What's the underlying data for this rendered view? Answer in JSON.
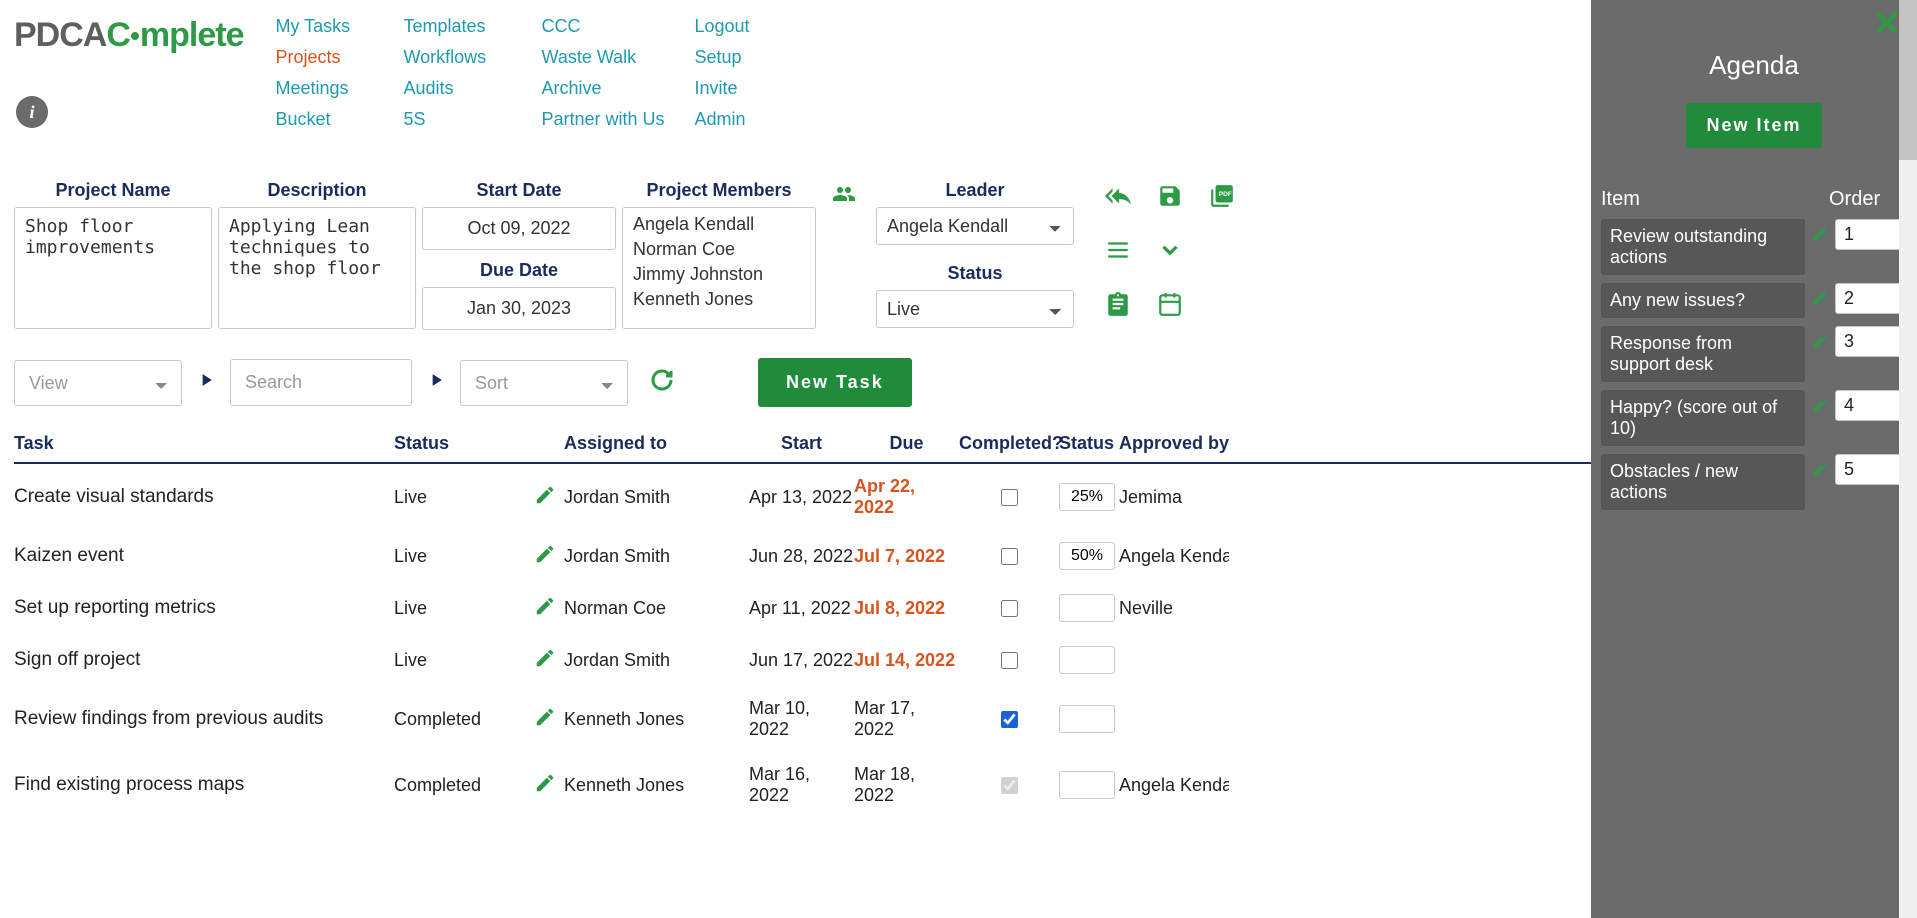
{
  "logo": {
    "part1": "PDCA",
    "part2": "C",
    "part3": "mplete"
  },
  "nav": {
    "my_tasks": "My Tasks",
    "templates": "Templates",
    "ccc": "CCC",
    "logout": "Logout",
    "projects": "Projects",
    "workflows": "Workflows",
    "waste_walk": "Waste Walk",
    "setup": "Setup",
    "meetings": "Meetings",
    "audits": "Audits",
    "archive": "Archive",
    "invite": "Invite",
    "bucket": "Bucket",
    "five_s": "5S",
    "partner": "Partner with Us",
    "admin": "Admin"
  },
  "info_glyph": "i",
  "project": {
    "labels": {
      "name": "Project Name",
      "desc": "Description",
      "start": "Start Date",
      "due": "Due Date",
      "members": "Project Members",
      "leader": "Leader",
      "status": "Status"
    },
    "name": "Shop floor improvements",
    "desc": "Applying Lean techniques to the shop floor",
    "start": "Oct 09, 2022",
    "due": "Jan 30, 2023",
    "members": [
      "Angela Kendall",
      "Norman Coe",
      "Jimmy Johnston",
      "Kenneth Jones"
    ],
    "leader": "Angela Kendall",
    "status": "Live"
  },
  "filters": {
    "view_placeholder": "View",
    "search_placeholder": "Search",
    "sort_placeholder": "Sort",
    "new_task": "New Task"
  },
  "table": {
    "headers": {
      "task": "Task",
      "status": "Status",
      "assigned": "Assigned to",
      "start": "Start",
      "due": "Due",
      "completed": "Completed?",
      "status2": "Status",
      "approved": "Approved by"
    },
    "rows": [
      {
        "task": "Create visual standards",
        "status": "Live",
        "assigned": "Jordan Smith",
        "start": "Apr 13, 2022",
        "due": "Apr 22, 2022",
        "overdue": true,
        "completed": false,
        "disabled": false,
        "pct": "25%",
        "approved": "Jemima"
      },
      {
        "task": "Kaizen event",
        "status": "Live",
        "assigned": "Jordan Smith",
        "start": "Jun 28, 2022",
        "due": "Jul 7, 2022",
        "overdue": true,
        "completed": false,
        "disabled": false,
        "pct": "50%",
        "approved": "Angela Kenda"
      },
      {
        "task": "Set up reporting metrics",
        "status": "Live",
        "assigned": "Norman Coe",
        "start": "Apr 11, 2022",
        "due": "Jul 8, 2022",
        "overdue": true,
        "completed": false,
        "disabled": false,
        "pct": "",
        "approved": "Neville"
      },
      {
        "task": "Sign off project",
        "status": "Live",
        "assigned": "Jordan Smith",
        "start": "Jun 17, 2022",
        "due": "Jul 14, 2022",
        "overdue": true,
        "completed": false,
        "disabled": false,
        "pct": "",
        "approved": ""
      },
      {
        "task": "Review findings from previous audits",
        "status": "Completed",
        "assigned": "Kenneth Jones",
        "start": "Mar 10, 2022",
        "due": "Mar 17, 2022",
        "overdue": false,
        "completed": true,
        "disabled": false,
        "pct": "",
        "approved": ""
      },
      {
        "task": "Find existing process maps",
        "status": "Completed",
        "assigned": "Kenneth Jones",
        "start": "Mar 16, 2022",
        "due": "Mar 18, 2022",
        "overdue": false,
        "completed": true,
        "disabled": true,
        "pct": "",
        "approved": "Angela Kenda"
      }
    ]
  },
  "sidebar": {
    "title": "Agenda",
    "new_item": "New Item",
    "hdr_item": "Item",
    "hdr_order": "Order",
    "items": [
      {
        "text": "Review outstanding actions",
        "order": "1"
      },
      {
        "text": "Any new issues?",
        "order": "2"
      },
      {
        "text": "Response from support desk",
        "order": "3"
      },
      {
        "text": "Happy? (score out of 10)",
        "order": "4"
      },
      {
        "text": "Obstacles / new actions",
        "order": "5"
      }
    ]
  }
}
